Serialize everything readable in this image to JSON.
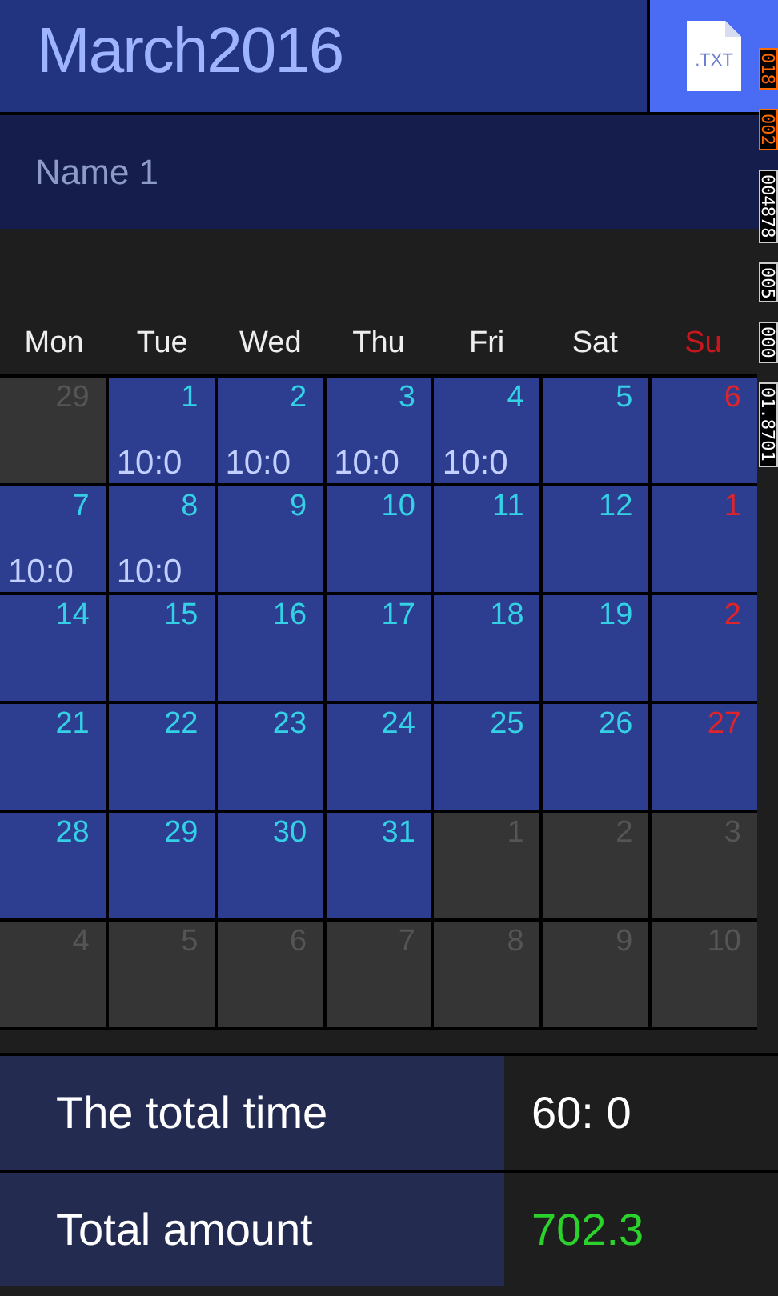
{
  "header": {
    "title": "March2016",
    "export_button": ".TXT"
  },
  "name_field": {
    "value": "Name 1"
  },
  "weekdays": [
    {
      "label": "Mon",
      "holiday": false
    },
    {
      "label": "Tue",
      "holiday": false
    },
    {
      "label": "Wed",
      "holiday": false
    },
    {
      "label": "Thu",
      "holiday": false
    },
    {
      "label": "Fri",
      "holiday": false
    },
    {
      "label": "Sat",
      "holiday": false
    },
    {
      "label": "Su",
      "holiday": true
    }
  ],
  "weeks": [
    [
      {
        "day": "29",
        "in_month": false,
        "holiday": false
      },
      {
        "day": "1",
        "in_month": true,
        "holiday": false,
        "hours": "10:0"
      },
      {
        "day": "2",
        "in_month": true,
        "holiday": false,
        "hours": "10:0"
      },
      {
        "day": "3",
        "in_month": true,
        "holiday": false,
        "hours": "10:0"
      },
      {
        "day": "4",
        "in_month": true,
        "holiday": false,
        "hours": "10:0"
      },
      {
        "day": "5",
        "in_month": true,
        "holiday": false
      },
      {
        "day": "6",
        "in_month": true,
        "holiday": true
      }
    ],
    [
      {
        "day": "7",
        "in_month": true,
        "holiday": false,
        "hours": "10:0"
      },
      {
        "day": "8",
        "in_month": true,
        "holiday": false,
        "hours": "10:0"
      },
      {
        "day": "9",
        "in_month": true,
        "holiday": false
      },
      {
        "day": "10",
        "in_month": true,
        "holiday": false
      },
      {
        "day": "11",
        "in_month": true,
        "holiday": false
      },
      {
        "day": "12",
        "in_month": true,
        "holiday": false
      },
      {
        "day": "1",
        "in_month": true,
        "holiday": true
      }
    ],
    [
      {
        "day": "14",
        "in_month": true,
        "holiday": false
      },
      {
        "day": "15",
        "in_month": true,
        "holiday": false
      },
      {
        "day": "16",
        "in_month": true,
        "holiday": false
      },
      {
        "day": "17",
        "in_month": true,
        "holiday": false
      },
      {
        "day": "18",
        "in_month": true,
        "holiday": false
      },
      {
        "day": "19",
        "in_month": true,
        "holiday": false
      },
      {
        "day": "2",
        "in_month": true,
        "holiday": true
      }
    ],
    [
      {
        "day": "21",
        "in_month": true,
        "holiday": false
      },
      {
        "day": "22",
        "in_month": true,
        "holiday": false
      },
      {
        "day": "23",
        "in_month": true,
        "holiday": false
      },
      {
        "day": "24",
        "in_month": true,
        "holiday": false
      },
      {
        "day": "25",
        "in_month": true,
        "holiday": false
      },
      {
        "day": "26",
        "in_month": true,
        "holiday": false
      },
      {
        "day": "27",
        "in_month": true,
        "holiday": true
      }
    ],
    [
      {
        "day": "28",
        "in_month": true,
        "holiday": false
      },
      {
        "day": "29",
        "in_month": true,
        "holiday": false
      },
      {
        "day": "30",
        "in_month": true,
        "holiday": false
      },
      {
        "day": "31",
        "in_month": true,
        "holiday": false
      },
      {
        "day": "1",
        "in_month": false,
        "holiday": false
      },
      {
        "day": "2",
        "in_month": false,
        "holiday": false
      },
      {
        "day": "3",
        "in_month": false,
        "holiday": false
      }
    ],
    [
      {
        "day": "4",
        "in_month": false,
        "holiday": false
      },
      {
        "day": "5",
        "in_month": false,
        "holiday": false
      },
      {
        "day": "6",
        "in_month": false,
        "holiday": false
      },
      {
        "day": "7",
        "in_month": false,
        "holiday": false
      },
      {
        "day": "8",
        "in_month": false,
        "holiday": false
      },
      {
        "day": "9",
        "in_month": false,
        "holiday": false
      },
      {
        "day": "10",
        "in_month": false,
        "holiday": false
      }
    ]
  ],
  "summary": [
    {
      "label": "The total time",
      "value": "60: 0",
      "kind": "time"
    },
    {
      "label": "Total amount",
      "value": "702.3",
      "kind": "money"
    }
  ],
  "frame_counters": [
    {
      "text": "018",
      "kind": "warning"
    },
    {
      "text": "002",
      "kind": "warning"
    },
    {
      "text": "004878",
      "kind": "normal"
    },
    {
      "text": "005",
      "kind": "normal"
    },
    {
      "text": "000",
      "kind": "normal"
    },
    {
      "text": "01.8701",
      "kind": "normal"
    }
  ]
}
